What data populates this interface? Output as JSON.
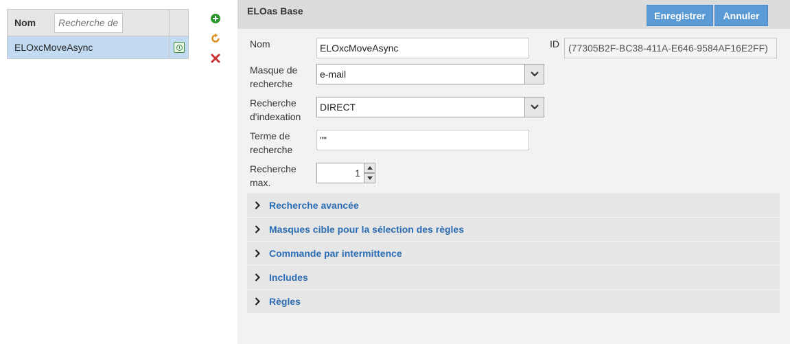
{
  "left": {
    "list_header": {
      "name_label": "Nom",
      "filter_placeholder": "Recherche de"
    },
    "rows": [
      {
        "name": "ELOxcMoveAsync",
        "icon": "timer-icon",
        "selected": true
      }
    ],
    "actions": [
      {
        "name": "add-icon",
        "color": "#2e9a2e"
      },
      {
        "name": "refresh-icon",
        "color": "#e0902a"
      },
      {
        "name": "delete-icon",
        "color": "#cc3333"
      }
    ]
  },
  "header": {
    "title": "ELOas Base",
    "save_label": "Enregistrer",
    "cancel_label": "Annuler"
  },
  "form": {
    "name_label": "Nom",
    "name_value": "ELOxcMoveAsync",
    "id_label": "ID",
    "id_value": "(77305B2F-BC38-411A-E646-9584AF16E2FF)",
    "search_mask_label_1": "Masque de",
    "search_mask_label_2": "recherche",
    "search_mask_value": "e-mail",
    "index_search_label_1": "Recherche",
    "index_search_label_2": "d'indexation",
    "index_search_value": "DIRECT",
    "search_term_label_1": "Terme de",
    "search_term_label_2": "recherche",
    "search_term_value": "\"\"",
    "max_search_label_1": "Recherche",
    "max_search_label_2": "max.",
    "max_search_value": "1"
  },
  "sections": [
    "Recherche avancée",
    "Masques cible pour la sélection des règles",
    "Commande par intermittence",
    "Includes",
    "Règles"
  ],
  "colors": {
    "accent": "#5b9bd5",
    "link": "#2a6db5",
    "selected_row": "#c3dbf2"
  }
}
